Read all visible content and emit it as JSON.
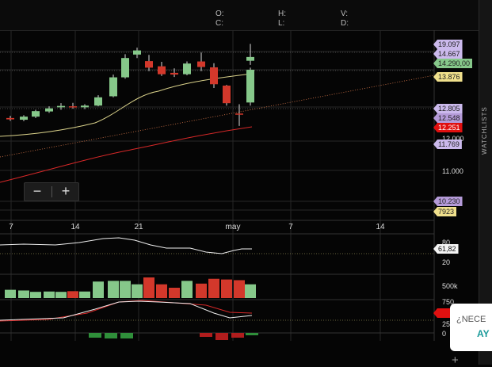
{
  "ohlc": {
    "open": "O:",
    "high": "H:",
    "volume": "V:",
    "close": "C:",
    "low": "L:",
    "date": "D:"
  },
  "colors": {
    "bull": "#86c88a",
    "bear": "#d3382b",
    "sma_fast": "#d9d18a",
    "sma_slow": "#d62828",
    "price_tag": "#cbb9ec",
    "green_tag": "#86c88a",
    "red_tag": "#e01010",
    "yellow_tag": "#f0e08c"
  },
  "x_axis_labels": [
    "7",
    "14",
    "21",
    "may",
    "7",
    "14"
  ],
  "price_axis_labels": [
    "12.000",
    "11.000"
  ],
  "price_tags": [
    {
      "label": "19.097",
      "color": "#cbb9ec"
    },
    {
      "label": "14.667",
      "color": "#cbb9ec"
    },
    {
      "label": "14.290,00",
      "color": "#86c88a"
    },
    {
      "label": "13.876",
      "color": "#f0e08c"
    },
    {
      "label": "12.805",
      "color": "#cbb9ec"
    },
    {
      "label": "12.548",
      "color": "#b49ad8"
    },
    {
      "label": "12.251",
      "color": "#e01010"
    },
    {
      "label": "11.769",
      "color": "#cbb9ec"
    },
    {
      "label": "10.230",
      "color": "#b49ad8"
    },
    {
      "label": "7923",
      "color": "#f0e08c"
    }
  ],
  "rsi_axis": [
    "80",
    "20"
  ],
  "rsi_tag": "61,82",
  "volume_axis": [
    "500k"
  ],
  "macd_axis": [
    "750",
    "250",
    "0"
  ],
  "candles": [
    {
      "o": 12520,
      "h": 12580,
      "l": 12440,
      "c": 12480
    },
    {
      "o": 12470,
      "h": 12600,
      "l": 12430,
      "c": 12560
    },
    {
      "o": 12560,
      "h": 12760,
      "l": 12520,
      "c": 12720
    },
    {
      "o": 12710,
      "h": 12860,
      "l": 12670,
      "c": 12800
    },
    {
      "o": 12830,
      "h": 12950,
      "l": 12760,
      "c": 12870
    },
    {
      "o": 12860,
      "h": 12960,
      "l": 12790,
      "c": 12830
    },
    {
      "o": 12830,
      "h": 12920,
      "l": 12780,
      "c": 12880
    },
    {
      "o": 12880,
      "h": 13180,
      "l": 12860,
      "c": 13120
    },
    {
      "o": 13150,
      "h": 13780,
      "l": 13120,
      "c": 13700
    },
    {
      "o": 13700,
      "h": 14370,
      "l": 13660,
      "c": 14260
    },
    {
      "o": 14360,
      "h": 14560,
      "l": 14260,
      "c": 14480
    },
    {
      "o": 14170,
      "h": 14350,
      "l": 13880,
      "c": 13980
    },
    {
      "o": 14020,
      "h": 14150,
      "l": 13740,
      "c": 13790
    },
    {
      "o": 13830,
      "h": 13960,
      "l": 13710,
      "c": 13780
    },
    {
      "o": 13790,
      "h": 14160,
      "l": 13760,
      "c": 14100
    },
    {
      "o": 14160,
      "h": 14420,
      "l": 13880,
      "c": 14000
    },
    {
      "o": 13990,
      "h": 14110,
      "l": 13390,
      "c": 13500
    },
    {
      "o": 13460,
      "h": 13480,
      "l": 12880,
      "c": 12950
    },
    {
      "o": 12650,
      "h": 12920,
      "l": 12290,
      "c": 12630
    },
    {
      "o": 12970,
      "h": 13980,
      "l": 12880,
      "c": 13920
    },
    {
      "o": 14180,
      "h": 14670,
      "l": 14060,
      "c": 14290
    }
  ],
  "volume_bars": [
    {
      "v": 120,
      "up": true
    },
    {
      "v": 110,
      "up": true
    },
    {
      "v": 90,
      "up": true
    },
    {
      "v": 95,
      "up": true
    },
    {
      "v": 90,
      "up": true
    },
    {
      "v": 100,
      "up": false
    },
    {
      "v": 95,
      "up": true
    },
    {
      "v": 240,
      "up": true
    },
    {
      "v": 250,
      "up": true
    },
    {
      "v": 250,
      "up": true
    },
    {
      "v": 200,
      "up": true
    },
    {
      "v": 300,
      "up": false
    },
    {
      "v": 200,
      "up": false
    },
    {
      "v": 150,
      "up": false
    },
    {
      "v": 250,
      "up": true
    },
    {
      "v": 210,
      "up": false
    },
    {
      "v": 280,
      "up": false
    },
    {
      "v": 270,
      "up": false
    },
    {
      "v": 260,
      "up": false
    },
    {
      "v": 200,
      "up": true
    },
    {
      "v": 190,
      "up": true
    }
  ]
}
